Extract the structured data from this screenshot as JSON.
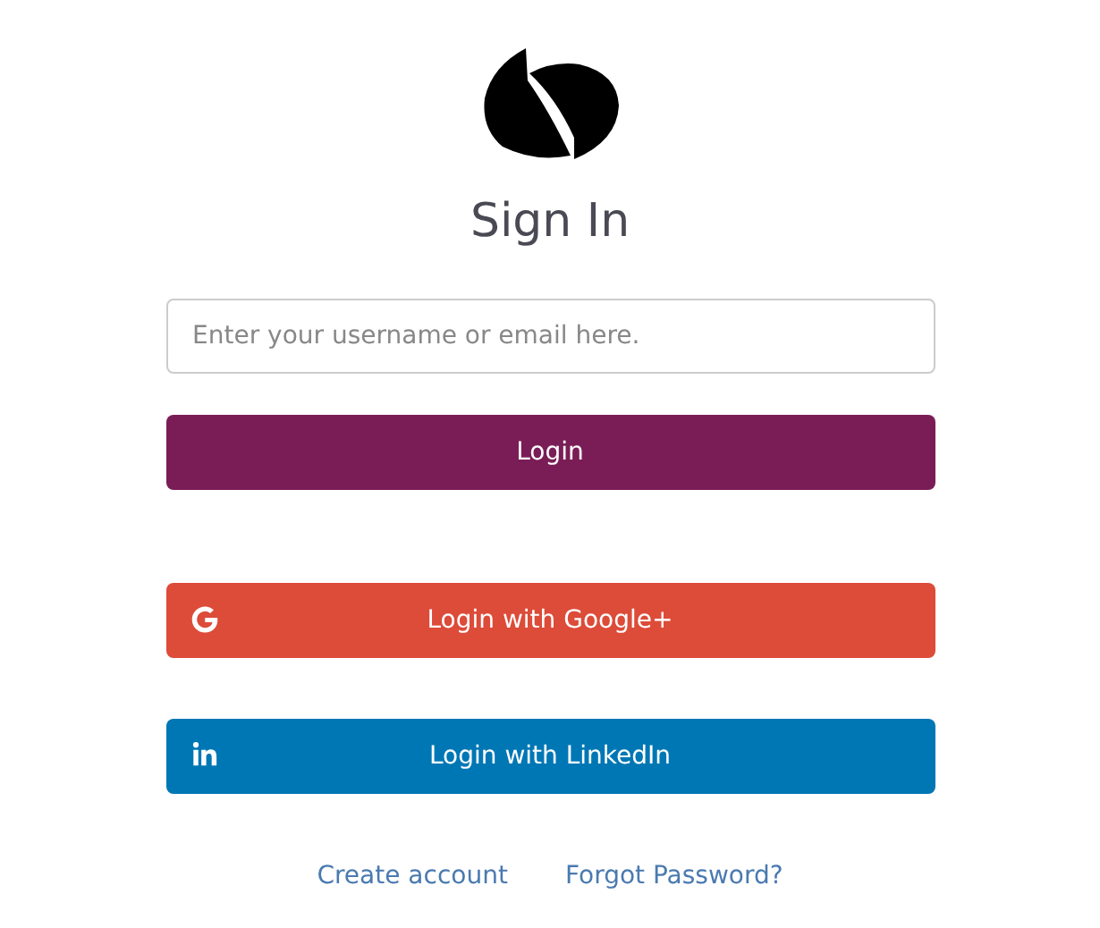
{
  "title": "Sign In",
  "username_field": {
    "placeholder": "Enter your username or email here."
  },
  "login_button": "Login",
  "social_buttons": [
    {
      "kind": "google",
      "label": "Login with Google+",
      "color": "#dd4b39"
    },
    {
      "kind": "linkedin",
      "label": "Login with LinkedIn",
      "color": "#0077b5"
    }
  ],
  "links": [
    "Create account",
    "Forgot Password?"
  ]
}
